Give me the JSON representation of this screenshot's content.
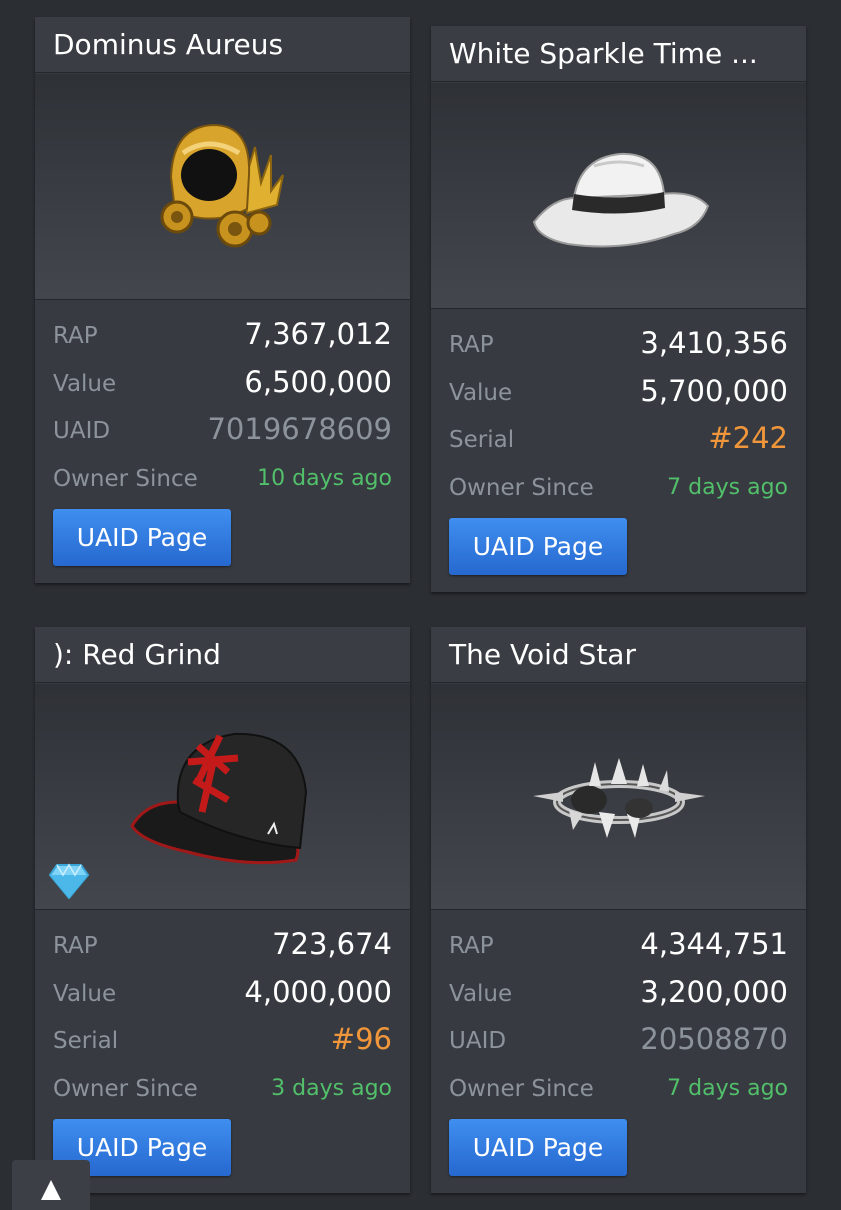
{
  "labels": {
    "rap": "RAP",
    "value": "Value",
    "uaid": "UAID",
    "serial": "Serial",
    "owner_since": "Owner Since",
    "uaid_button": "UAID Page"
  },
  "items": [
    {
      "name": "Dominus Aureus",
      "icon": "dominus-aureus-hat",
      "rap": "7,367,012",
      "value": "6,500,000",
      "id_label": "UAID",
      "id_value": "7019678609",
      "owner_since": "10 days ago"
    },
    {
      "name": "White Sparkle Time ...",
      "icon": "white-fedora-hat",
      "rap": "3,410,356",
      "value": "5,700,000",
      "id_label": "Serial",
      "id_value": "#242",
      "owner_since": "7 days ago"
    },
    {
      "name": "): Red Grind",
      "icon": "red-grind-cap",
      "rap": "723,674",
      "value": "4,000,000",
      "id_label": "Serial",
      "id_value": "#96",
      "owner_since": "3 days ago",
      "badge": "diamond-icon"
    },
    {
      "name": "The Void Star",
      "icon": "void-star-crown",
      "rap": "4,344,751",
      "value": "3,200,000",
      "id_label": "UAID",
      "id_value": "20508870",
      "owner_since": "7 days ago"
    }
  ],
  "colors": {
    "background": "#2b2e33",
    "card": "#373b41",
    "serial": "#f1963a",
    "owner_since": "#52bf6a",
    "button": "#2f7ae3"
  }
}
